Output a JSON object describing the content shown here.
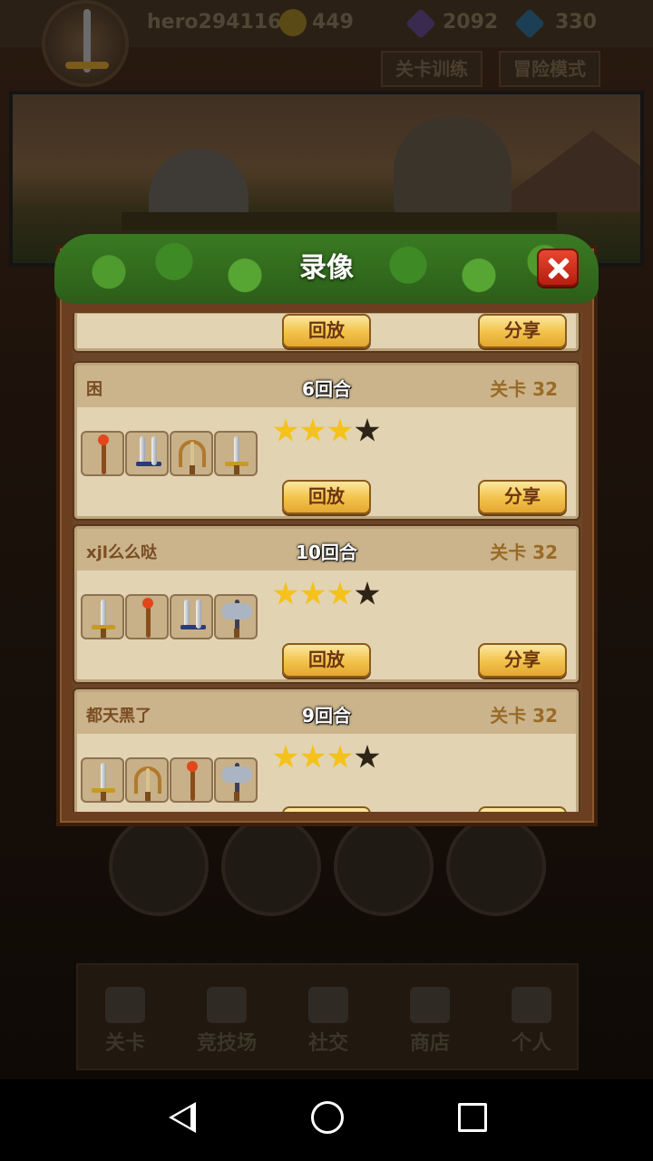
{
  "topbar": {
    "username": "hero294116",
    "coins": "449",
    "gems": "2092",
    "diamonds": "330",
    "tabs": [
      "关卡训练",
      "冒险模式"
    ]
  },
  "modal": {
    "title": "录像",
    "close_icon": "close-x-icon",
    "replay_label": "回放",
    "share_label": "分享",
    "entries": [
      {
        "player": "",
        "rounds": "",
        "level": ""
      },
      {
        "player": "困",
        "rounds": "6回合",
        "level": "关卡 32",
        "stars": 3,
        "max_stars": 4,
        "weapons": [
          "staff",
          "dual-daggers",
          "bow",
          "sword"
        ]
      },
      {
        "player": "xjl么么哒",
        "rounds": "10回合",
        "level": "关卡 32",
        "stars": 3,
        "max_stars": 4,
        "weapons": [
          "sword",
          "staff",
          "dual-daggers",
          "axe"
        ]
      },
      {
        "player": "都天黑了",
        "rounds": "9回合",
        "level": "关卡 32",
        "stars": 3,
        "max_stars": 4,
        "weapons": [
          "sword",
          "bow",
          "staff",
          "axe"
        ]
      }
    ]
  },
  "bottom_nav": {
    "items": [
      "关卡",
      "竞技场",
      "社交",
      "商店",
      "个人"
    ]
  },
  "colors": {
    "card_bg": "#e2d3b3",
    "button_gold": "#f3c54f",
    "star_on": "#f4c21a",
    "close_red": "#d93a24"
  }
}
